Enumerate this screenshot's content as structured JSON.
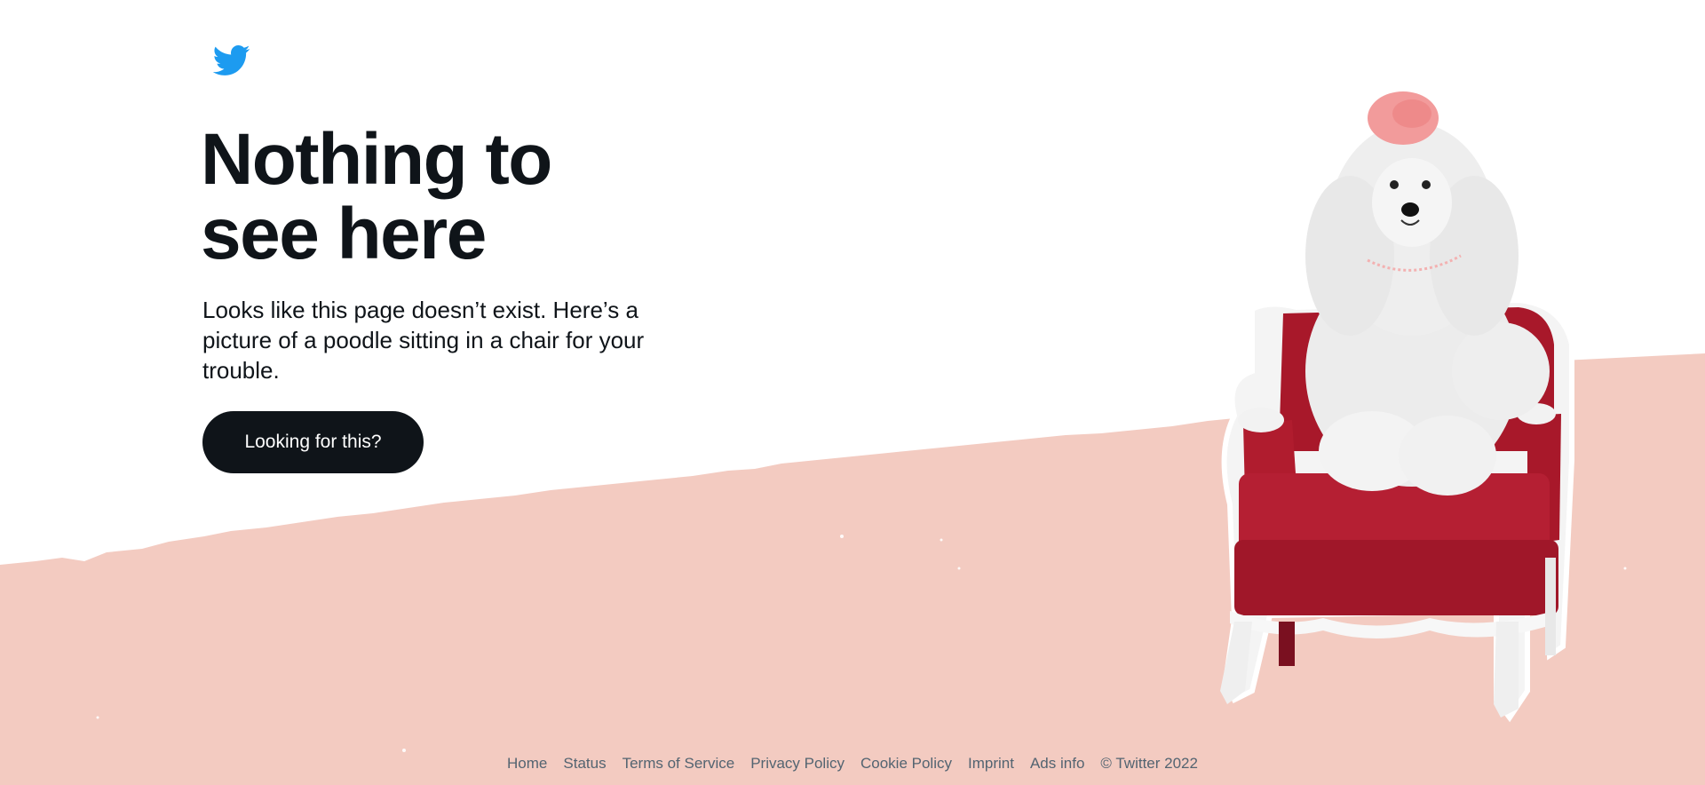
{
  "colors": {
    "brand_blue": "#1d9bf0",
    "blush": "#f3cbc1",
    "text": "#0f1419",
    "muted": "#536471",
    "chair_red": "#b01c2e"
  },
  "header": {
    "logo_icon": "twitter-bird-icon"
  },
  "main": {
    "headline_line1": "Nothing to",
    "headline_line2": "see here",
    "subtext": "Looks like this page doesn’t exist. Here’s a picture of a poodle sitting in a chair for your trouble.",
    "cta_label": "Looking for this?"
  },
  "illustration": {
    "icon": "poodle-in-chair-illustration"
  },
  "footer": {
    "links": [
      "Home",
      "Status",
      "Terms of Service",
      "Privacy Policy",
      "Cookie Policy",
      "Imprint",
      "Ads info"
    ],
    "copyright": "© Twitter 2022"
  }
}
